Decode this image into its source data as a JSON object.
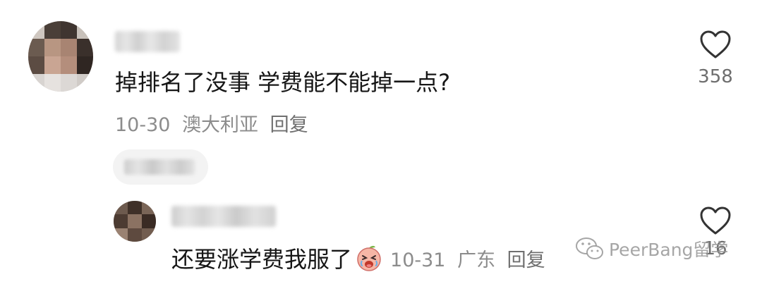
{
  "comment": {
    "text": "掉排名了没事 学费能不能掉一点?",
    "date": "10-30",
    "location": "澳大利亚",
    "reply_label": "回复",
    "like_count": "358"
  },
  "reply": {
    "text": "还要涨学费我服了",
    "emoji_name": "crying-peach-emoji",
    "date": "10-31",
    "location": "广东",
    "reply_label": "回复",
    "like_count": "16"
  },
  "watermark": {
    "text": "PeerBang留学"
  },
  "colors": {
    "text_primary": "#161616",
    "text_secondary": "#8c8c8c",
    "background": "#ffffff"
  }
}
